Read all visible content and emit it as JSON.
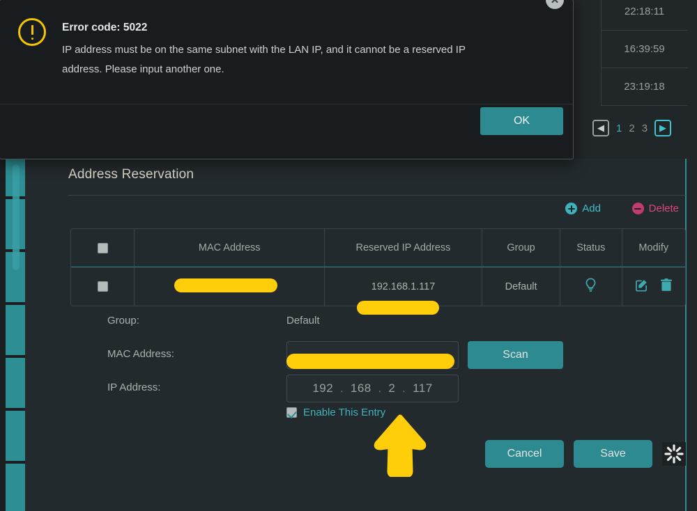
{
  "dialog": {
    "error_code_label": "Error code: 5022",
    "message": "IP address must be on the same subnet with the LAN IP, and it cannot be a reserved IP address. Please input another one.",
    "ok_label": "OK",
    "close_glyph": "✕",
    "warning_icon": "exclamation-circle-icon",
    "accent_color": "#f5c400"
  },
  "background_list": {
    "rows": [
      {
        "time": "22:18:11"
      },
      {
        "time": "16:39:59"
      },
      {
        "time": "23:19:18"
      }
    ],
    "pagination": {
      "prev_glyph": "◀",
      "next_glyph": "▶",
      "pages": [
        "1",
        "2",
        "3"
      ],
      "active_page": "1"
    }
  },
  "panel": {
    "title": "Address Reservation",
    "toolbar": {
      "add_label": "Add",
      "add_color": "#3ec0ca",
      "delete_label": "Delete",
      "delete_color": "#d9477f"
    },
    "table": {
      "headers": [
        "",
        "MAC Address",
        "Reserved IP Address",
        "Group",
        "Status",
        "Modify"
      ],
      "rows": [
        {
          "mac": "",
          "ip": "192.168.1.117",
          "group": "Default",
          "status_icon": "lightbulb-icon",
          "modify_icons": [
            "edit-icon",
            "delete-icon"
          ]
        }
      ]
    },
    "form": {
      "group_label": "Group:",
      "group_value": "Default",
      "mac_label": "MAC Address:",
      "mac_value": "",
      "scan_label": "Scan",
      "ip_label": "IP Address:",
      "ip_octets": [
        "192",
        "168",
        "2",
        "117"
      ],
      "ip_separator": ".",
      "enable_label": "Enable This Entry",
      "enable_checked": true,
      "cancel_label": "Cancel",
      "save_label": "Save",
      "spinner_icon": "loading-spinner-icon"
    }
  },
  "theme": {
    "teal": "#2d8a90",
    "teal_light": "#3fb3bd",
    "background": "#212629",
    "panel": "#232a2d",
    "annotation_yellow": "#ffce0a"
  }
}
